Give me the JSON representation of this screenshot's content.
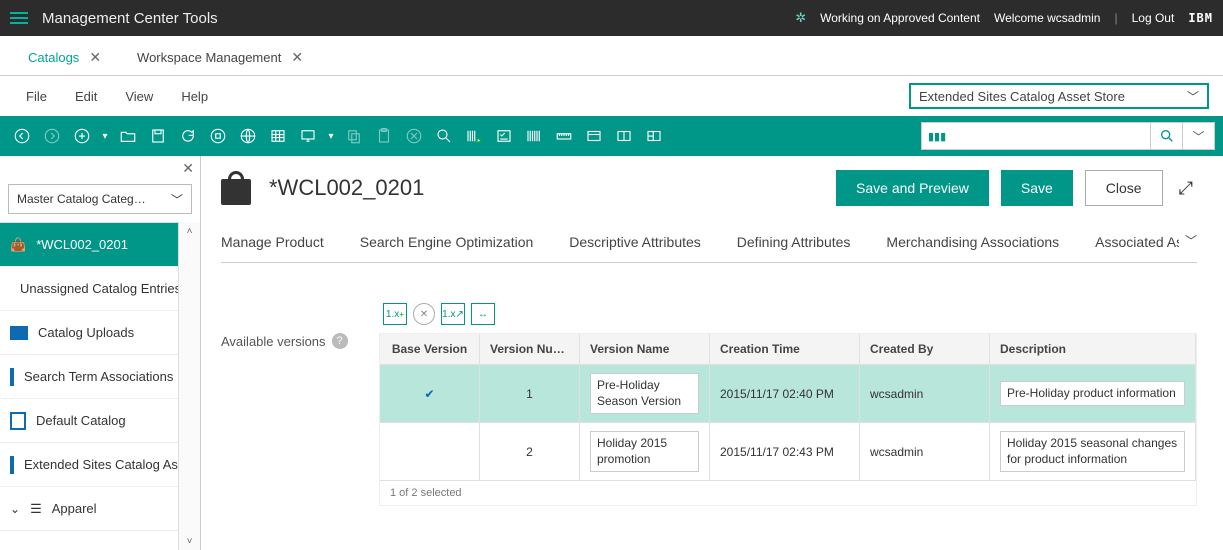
{
  "top": {
    "title": "Management Center Tools",
    "working_label": "Working on Approved Content",
    "welcome_label": "Welcome wcsadmin",
    "logout_label": "Log Out",
    "ibm": "IBM"
  },
  "global_tabs": [
    {
      "label": "Catalogs",
      "active": true
    },
    {
      "label": "Workspace Management",
      "active": false
    }
  ],
  "menubar": {
    "file": "File",
    "edit": "Edit",
    "view": "View",
    "help": "Help"
  },
  "store_select": {
    "value": "Extended Sites Catalog Asset Store"
  },
  "search_box": {
    "value": ""
  },
  "left_panel": {
    "selector": "Master Catalog Categories",
    "tree": [
      {
        "label": "*WCL002_0201",
        "icon": "bag",
        "selected": true
      },
      {
        "label": "Unassigned Catalog Entries",
        "icon": "folder"
      },
      {
        "label": "Catalog Uploads",
        "icon": "folder"
      },
      {
        "label": "Search Term Associations",
        "icon": "doc"
      },
      {
        "label": "Default Catalog",
        "icon": "doc"
      },
      {
        "label": "Extended Sites Catalog Asset Store",
        "icon": "doc"
      },
      {
        "label": "Apparel",
        "icon": "menu"
      }
    ]
  },
  "page": {
    "title": "*WCL002_0201",
    "save_preview": "Save and Preview",
    "save": "Save",
    "close": "Close"
  },
  "inner_tabs": [
    "Manage Product",
    "Search Engine Optimization",
    "Descriptive Attributes",
    "Defining Attributes",
    "Merchandising Associations",
    "Associated Assets"
  ],
  "versions": {
    "label": "Available versions",
    "headers": {
      "base": "Base Version",
      "num": "Version Number",
      "name": "Version Name",
      "created_time": "Creation Time",
      "created_by": "Created By",
      "desc": "Description"
    },
    "rows": [
      {
        "base": true,
        "num": "1",
        "name": "Pre-Holiday Season Version",
        "created_time": "2015/11/17 02:40 PM",
        "created_by": "wcsadmin",
        "desc": "Pre-Holiday product information",
        "selected": true
      },
      {
        "base": false,
        "num": "2",
        "name": "Holiday 2015 promotion",
        "created_time": "2015/11/17 02:43 PM",
        "created_by": "wcsadmin",
        "desc": "Holiday 2015 seasonal changes for product information",
        "selected": false
      }
    ],
    "footer": "1 of 2 selected"
  }
}
